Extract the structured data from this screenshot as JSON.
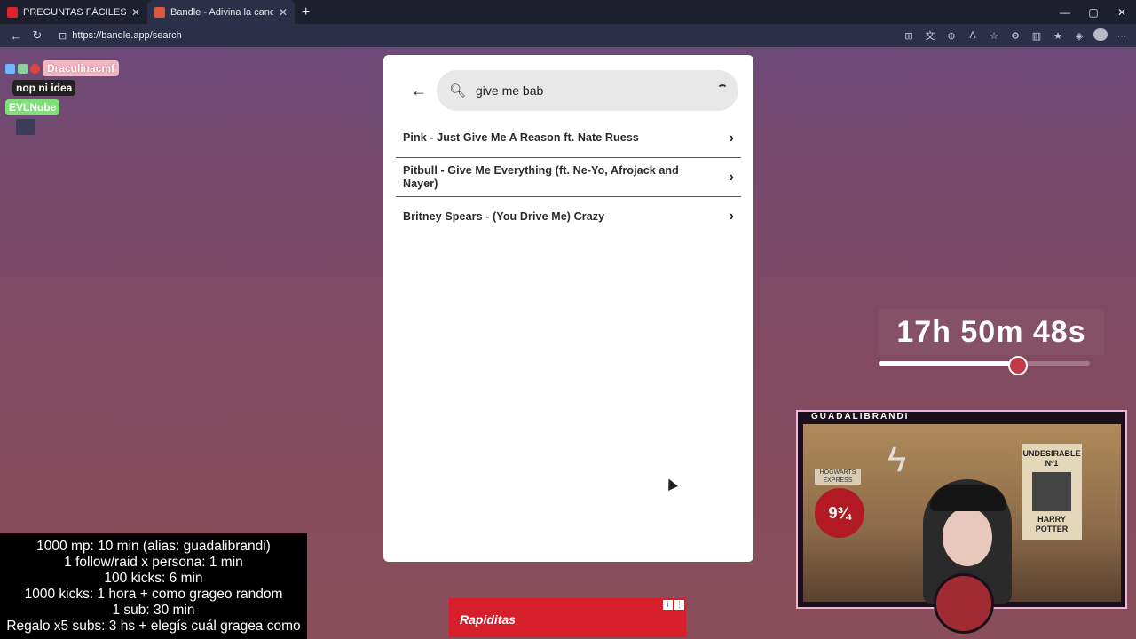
{
  "browser": {
    "tabs": [
      {
        "title": "PREGUNTAS FÁCILES especial en C",
        "active": false,
        "favicon_color": "#e0202a"
      },
      {
        "title": "Bandle - Adivina la canción, un ins",
        "active": true,
        "favicon_color": "#d9573b"
      }
    ],
    "new_tab": "+",
    "url": "https://bandle.app/search",
    "window_controls": [
      "—",
      "▢",
      "✕"
    ]
  },
  "chat": {
    "messages": [
      {
        "user": "Draculinacmf",
        "text": "nop ni idea"
      },
      {
        "user": "EVLNube",
        "text": ""
      }
    ]
  },
  "search": {
    "query": "give me bab",
    "back_label": "←",
    "search_icon": "search-icon"
  },
  "results": [
    {
      "label": "Pink - Just Give Me A Reason ft. Nate Ruess"
    },
    {
      "label": "Pitbull - Give Me Everything (ft. Ne-Yo, Afrojack and Nayer)"
    },
    {
      "label": "Britney Spears - (You Drive Me) Crazy"
    }
  ],
  "subathon": {
    "lines": [
      "1000 mp: 10 min (alias: guadalibrandi)",
      "1 follow/raid x persona: 1 min",
      "100 kicks: 6 min",
      "1000 kicks: 1 hora + como grageo random",
      "1 sub: 30 min",
      "Regalo x5 subs: 3 hs + elegís cuál gragea como"
    ]
  },
  "timer": {
    "text": "17h 50m 48s",
    "progress": 0.62
  },
  "webcam": {
    "channel_name": "GUADALIBRANDI",
    "poster_text": "HOGWARTS EXPRESS",
    "platform_text": "9¾",
    "wanted_title": "UNDESIRABLE",
    "wanted_number": "Nº1",
    "wanted_name": "HARRY POTTER"
  },
  "ad": {
    "brand": "Rapiditas"
  },
  "colors": {
    "accent": "#d61f2b",
    "modal_bg": "#ffffff",
    "search_bg": "#e8e8e8"
  }
}
